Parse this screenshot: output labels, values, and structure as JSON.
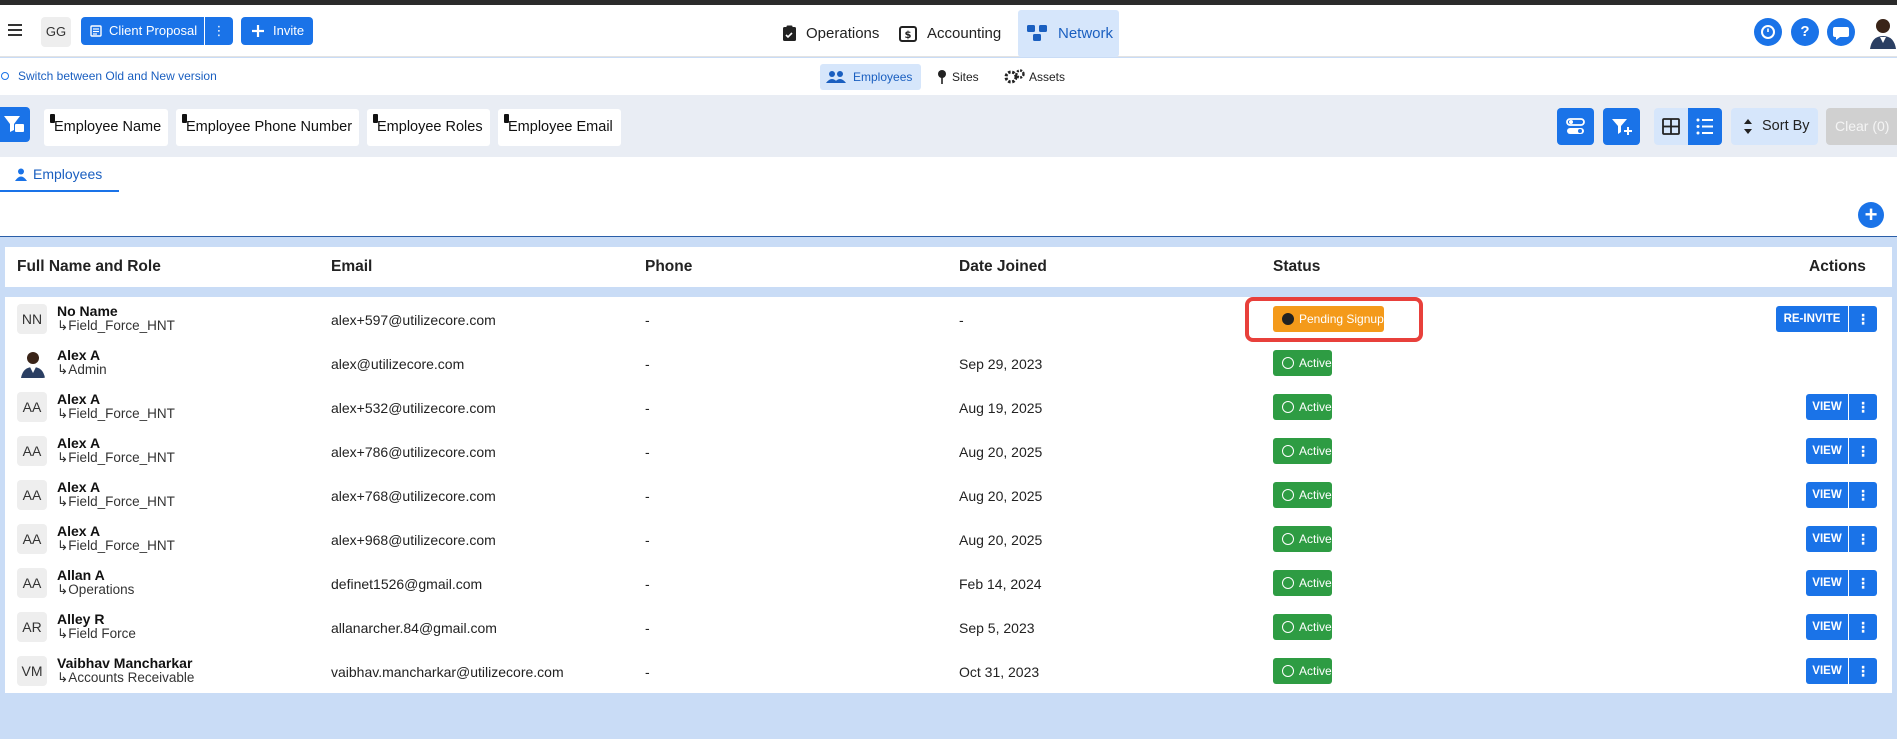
{
  "header": {
    "workspace_initials": "GG",
    "client_proposal_label": "Client Proposal",
    "invite_label": "Invite",
    "nav": [
      {
        "label": "Operations"
      },
      {
        "label": "Accounting"
      },
      {
        "label": "Network"
      }
    ]
  },
  "subbar": {
    "switch_label": "Switch between Old and New version",
    "tabs": [
      {
        "label": "Employees"
      },
      {
        "label": "Sites"
      },
      {
        "label": "Assets"
      }
    ]
  },
  "filters": {
    "chips": [
      "Employee Name",
      "Employee Phone Number",
      "Employee Roles",
      "Employee Email"
    ],
    "sort_label": "Sort By",
    "clear_label": "Clear (0)"
  },
  "panel": {
    "tab_label": "Employees"
  },
  "table": {
    "columns": [
      "Full Name and Role",
      "Email",
      "Phone",
      "Date Joined",
      "Status",
      "Actions"
    ],
    "rows": [
      {
        "initials": "NN",
        "name": "No Name",
        "role": "↳Field_Force_HNT",
        "email": "alex+597@utilizecore.com",
        "phone": "-",
        "joined": "-",
        "status": "Pending Signup",
        "action": "RE-INVITE"
      },
      {
        "initials": "",
        "name": "Alex A",
        "role": "↳Admin",
        "email": "alex@utilizecore.com",
        "phone": "-",
        "joined": "Sep 29, 2023",
        "status": "Active",
        "action": ""
      },
      {
        "initials": "AA",
        "name": "Alex A",
        "role": "↳Field_Force_HNT",
        "email": "alex+532@utilizecore.com",
        "phone": "-",
        "joined": "Aug 19, 2025",
        "status": "Active",
        "action": "VIEW"
      },
      {
        "initials": "AA",
        "name": "Alex A",
        "role": "↳Field_Force_HNT",
        "email": "alex+786@utilizecore.com",
        "phone": "-",
        "joined": "Aug 20, 2025",
        "status": "Active",
        "action": "VIEW"
      },
      {
        "initials": "AA",
        "name": "Alex A",
        "role": "↳Field_Force_HNT",
        "email": "alex+768@utilizecore.com",
        "phone": "-",
        "joined": "Aug 20, 2025",
        "status": "Active",
        "action": "VIEW"
      },
      {
        "initials": "AA",
        "name": "Alex A",
        "role": "↳Field_Force_HNT",
        "email": "alex+968@utilizecore.com",
        "phone": "-",
        "joined": "Aug 20, 2025",
        "status": "Active",
        "action": "VIEW"
      },
      {
        "initials": "AA",
        "name": "Allan A",
        "role": "↳Operations",
        "email": "definet1526@gmail.com",
        "phone": "-",
        "joined": "Feb 14, 2024",
        "status": "Active",
        "action": "VIEW"
      },
      {
        "initials": "AR",
        "name": "Alley R",
        "role": "↳Field Force",
        "email": "allanarcher.84@gmail.com",
        "phone": "-",
        "joined": "Sep 5, 2023",
        "status": "Active",
        "action": "VIEW"
      },
      {
        "initials": "VM",
        "name": "Vaibhav Mancharkar",
        "role": "↳Accounts Receivable",
        "email": "vaibhav.mancharkar@utilizecore.com",
        "phone": "-",
        "joined": "Oct 31, 2023",
        "status": "Active",
        "action": "VIEW"
      }
    ]
  },
  "colors": {
    "primary": "#1a73e8",
    "active": "#2e9c43",
    "pending": "#f49a1a",
    "highlight": "#e8403b"
  },
  "icons": [
    "menu-icon",
    "document-icon",
    "more-vert-icon",
    "plus-icon",
    "operations-icon",
    "accounting-icon",
    "network-icon",
    "help-icon",
    "chat-icon",
    "employees-icon",
    "pin-icon",
    "gear-icon",
    "filter-icon",
    "grid-icon",
    "list-icon",
    "sort-icon",
    "person-icon",
    "check-circle-icon",
    "info-icon"
  ]
}
